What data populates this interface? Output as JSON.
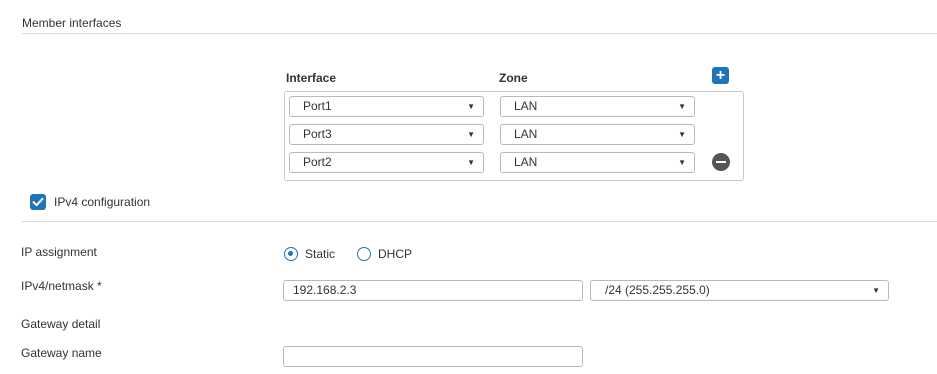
{
  "section": {
    "title": "Member interfaces"
  },
  "members": {
    "interface_header": "Interface",
    "zone_header": "Zone",
    "rows": [
      {
        "interface": "Port1",
        "zone": "LAN"
      },
      {
        "interface": "Port3",
        "zone": "LAN"
      },
      {
        "interface": "Port2",
        "zone": "LAN"
      }
    ]
  },
  "ipv4": {
    "checkbox_label": "IPv4 configuration",
    "checked": true
  },
  "form": {
    "ip_assignment_label": "IP assignment",
    "static_label": "Static",
    "dhcp_label": "DHCP",
    "selected_assignment": "Static",
    "ipv4_label": "IPv4/netmask *",
    "ipv4_value": "192.168.2.3",
    "netmask_value": "/24 (255.255.255.0)",
    "gateway_detail_label": "Gateway detail",
    "gateway_name_label": "Gateway name",
    "gateway_name_value": ""
  },
  "colors": {
    "accent": "#1f73b7",
    "remove": "#555555"
  },
  "icons": {
    "add": "plus-icon",
    "remove": "minus-circle-icon",
    "dropdown": "caret-down-icon",
    "check": "checkmark-icon"
  }
}
